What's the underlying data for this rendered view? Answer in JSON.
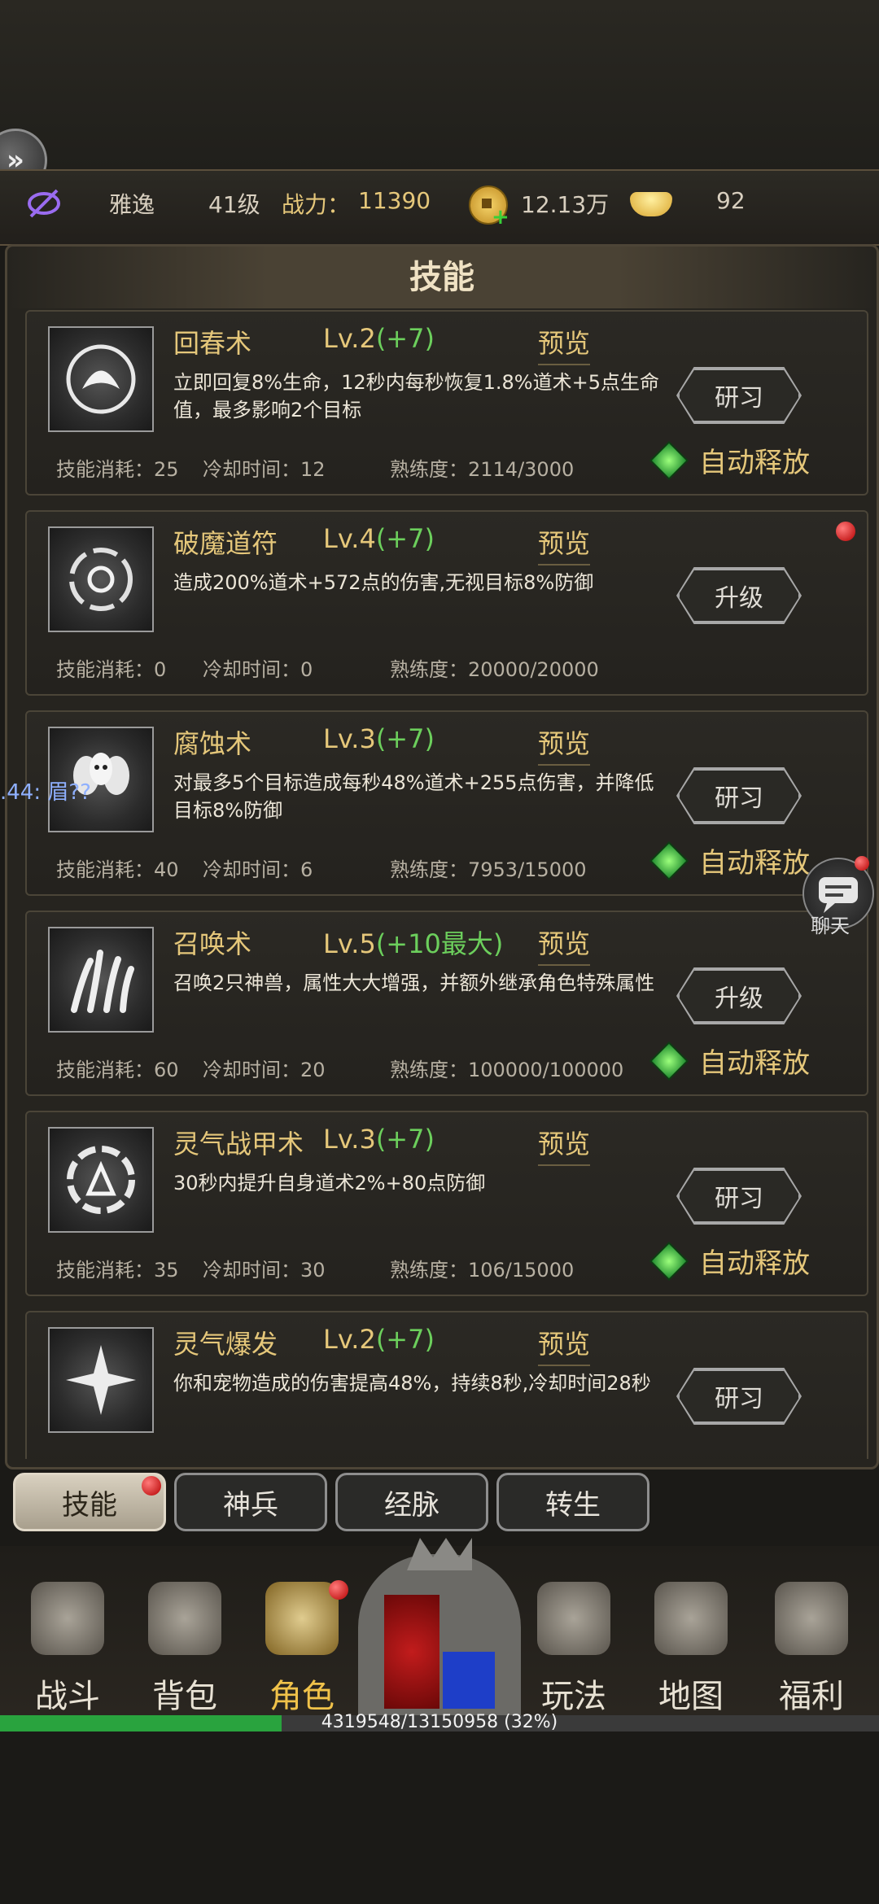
{
  "header": {
    "name": "雅逸",
    "level": "41级",
    "power_label": "战力：",
    "power_value": "11390",
    "gold": "12.13万",
    "ingot": "92"
  },
  "panel": {
    "title": "技能"
  },
  "skills": [
    {
      "name": "回春术",
      "level": "Lv.2",
      "bonus": "(+7)",
      "preview": "预览",
      "desc": "立即回复8%生命，12秒内每秒恢复1.8%道术+5点生命值，最多影响2个目标",
      "cost": "技能消耗：25",
      "cooldown": "冷却时间：12",
      "mastery": "熟练度：2114/3000",
      "action": "研习",
      "auto": "自动释放"
    },
    {
      "name": "破魔道符",
      "level": "Lv.4",
      "bonus": "(+7)",
      "preview": "预览",
      "desc": "造成200%道术+572点的伤害,无视目标8%防御",
      "cost": "技能消耗：0",
      "cooldown": "冷却时间：0",
      "mastery": "熟练度：20000/20000",
      "action": "升级",
      "auto": ""
    },
    {
      "name": "腐蚀术",
      "level": "Lv.3",
      "bonus": "(+7)",
      "preview": "预览",
      "desc": "对最多5个目标造成每秒48%道术+255点伤害，并降低目标8%防御",
      "cost": "技能消耗：40",
      "cooldown": "冷却时间：6",
      "mastery": "熟练度：7953/15000",
      "action": "研习",
      "auto": "自动释放"
    },
    {
      "name": "召唤术",
      "level": "Lv.5",
      "bonus": "(+10最大)",
      "preview": "预览",
      "desc": "召唤2只神兽，属性大大增强，并额外继承角色特殊属性",
      "cost": "技能消耗：60",
      "cooldown": "冷却时间：20",
      "mastery": "熟练度：100000/100000",
      "action": "升级",
      "auto": "自动释放"
    },
    {
      "name": "灵气战甲术",
      "level": "Lv.3",
      "bonus": "(+7)",
      "preview": "预览",
      "desc": "30秒内提升自身道术2%+80点防御",
      "cost": "技能消耗：35",
      "cooldown": "冷却时间：30",
      "mastery": "熟练度：106/15000",
      "action": "研习",
      "auto": "自动释放"
    },
    {
      "name": "灵气爆发",
      "level": "Lv.2",
      "bonus": "(+7)",
      "preview": "预览",
      "desc": "你和宠物造成的伤害提高48%，持续8秒,冷却时间28秒",
      "cost": "",
      "cooldown": "",
      "mastery": "",
      "action": "研习",
      "auto": ""
    }
  ],
  "float_text": ".44: 眉??",
  "chat": {
    "label": "聊天"
  },
  "tabs": [
    "技能",
    "神兵",
    "经脉",
    "转生"
  ],
  "nav": [
    "战斗",
    "背包",
    "角色",
    "玩法",
    "地图",
    "福利"
  ],
  "xp": {
    "text": "4319548/13150958 (32%)",
    "progress": 0.32
  }
}
